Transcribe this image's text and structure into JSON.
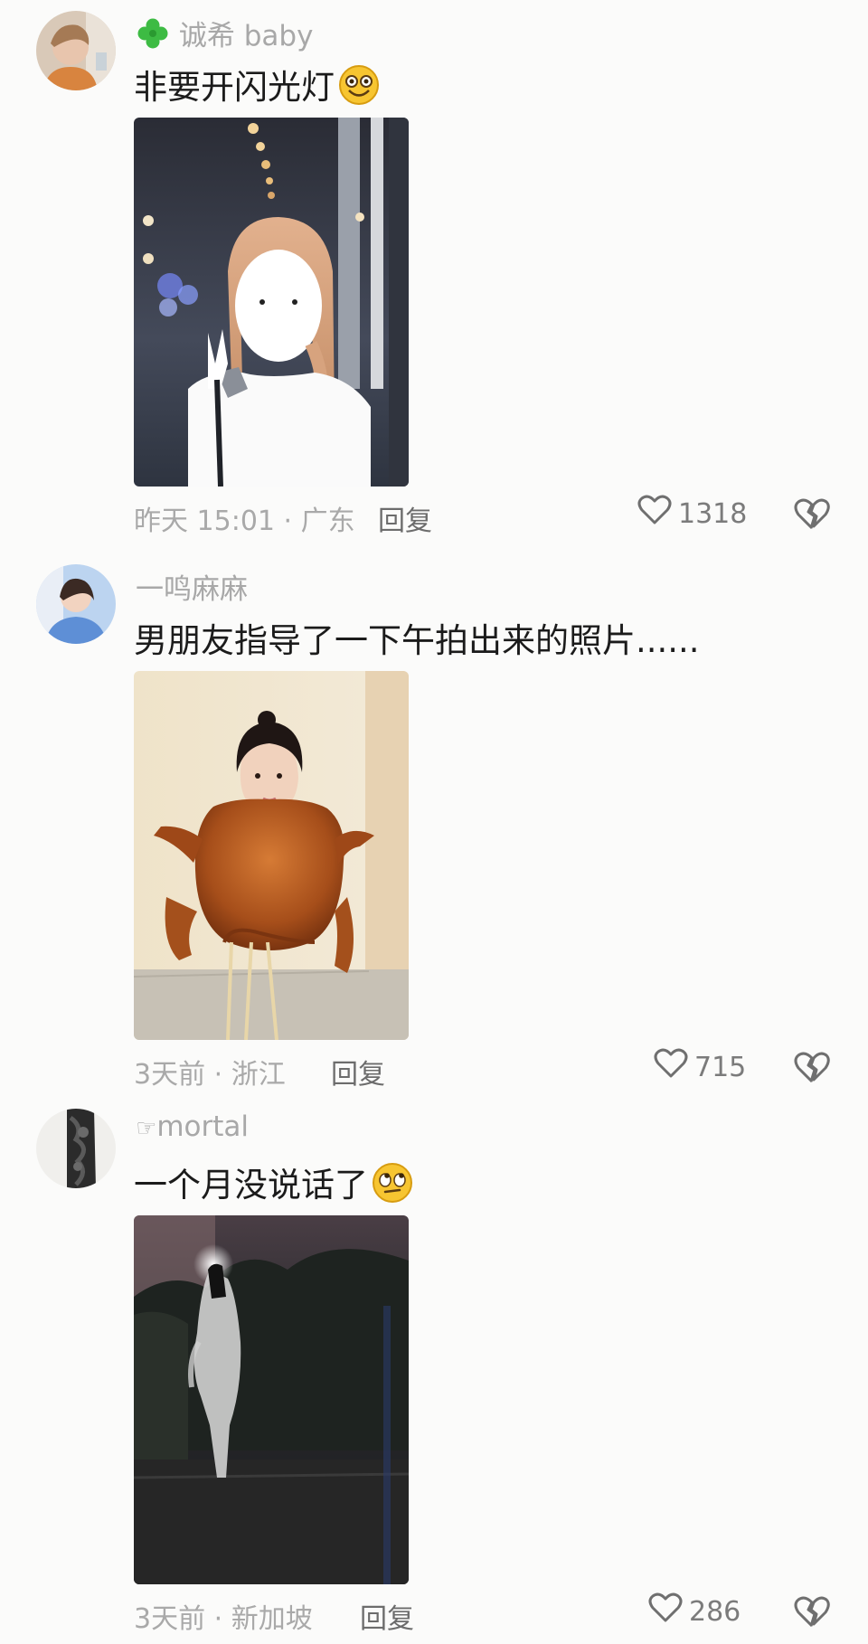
{
  "comments": [
    {
      "username": "诚希 baby",
      "text": "非要开闪光灯",
      "time_location": "昨天 15:01 · 广东",
      "reply_label": "回复",
      "likes": "1318"
    },
    {
      "username": "一鸣麻麻",
      "text": "男朋友指导了一下午拍出来的照片......",
      "time_location": "3天前 · 浙江",
      "reply_label": "回复",
      "likes": "715"
    },
    {
      "username": "mortal",
      "text": "一个月没说话了",
      "time_location": "3天前 · 新加坡",
      "reply_label": "回复",
      "likes": "286"
    }
  ],
  "icons": {
    "like": "heart-outline-icon",
    "dislike": "broken-heart-icon",
    "badge": "clover-icon",
    "prefix": "pointing-hand-icon"
  }
}
